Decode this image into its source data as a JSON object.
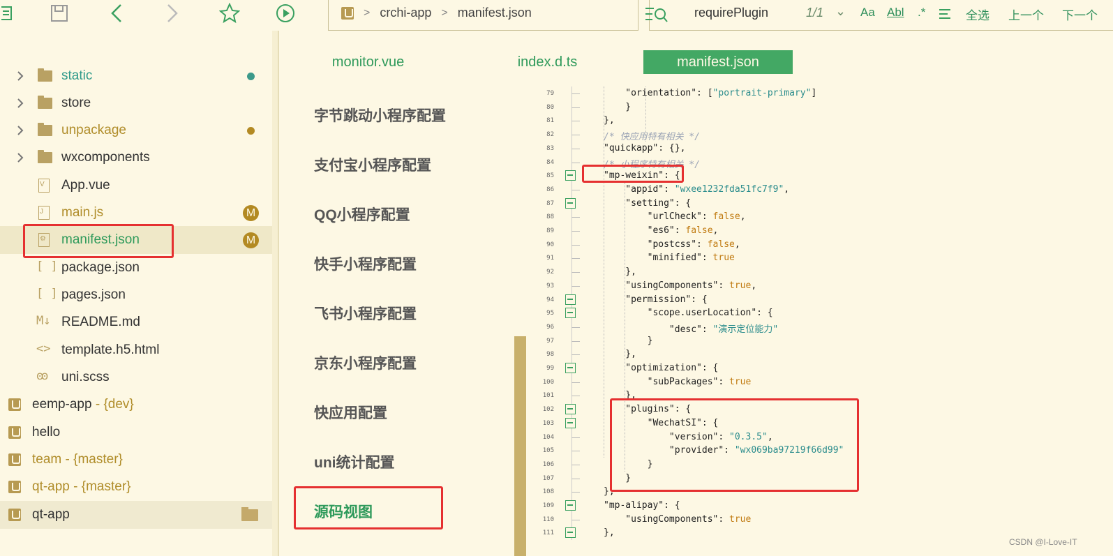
{
  "breadcrumb": {
    "project": "crchi-app",
    "file": "manifest.json"
  },
  "search": {
    "query": "requirePlugin",
    "count": "1/1",
    "aa": "Aa",
    "ab": "Abl",
    "regex": ".*",
    "select_all": "全选",
    "prev": "上一个",
    "next": "下一个"
  },
  "tree": {
    "folders": [
      "static",
      "store",
      "unpackage",
      "wxcomponents"
    ],
    "files": [
      "App.vue",
      "main.js",
      "manifest.json",
      "package.json",
      "pages.json",
      "README.md",
      "template.h5.html",
      "uni.scss"
    ],
    "file_glyphs": {
      "vue": "V",
      "js": "J",
      "json": "[ ]",
      "md": "M↓",
      "html": "<>",
      "scss": "ꙭ"
    },
    "badge_m": "M",
    "projects": [
      {
        "name": "eemp-app",
        "branch": " - {dev}"
      },
      {
        "name": "hello",
        "branch": ""
      },
      {
        "name": "team",
        "branch": " - {master}"
      },
      {
        "name": "qt-app",
        "branch": " - {master}"
      },
      {
        "name": "qt-app",
        "branch": ""
      }
    ]
  },
  "tabs": [
    "monitor.vue",
    "index.d.ts",
    "manifest.json"
  ],
  "nav": [
    "字节跳动小程序配置",
    "支付宝小程序配置",
    "QQ小程序配置",
    "快手小程序配置",
    "飞书小程序配置",
    "京东小程序配置",
    "快应用配置",
    "uni统计配置",
    "源码视图"
  ],
  "code": {
    "line_numbers": [
      "79",
      "80",
      "81",
      "82",
      "83",
      "84",
      "85",
      "86",
      "87",
      "88",
      "89",
      "90",
      "91",
      "92",
      "93",
      "94",
      "95",
      "96",
      "97",
      "98",
      "99",
      "100",
      "101",
      "102",
      "103",
      "104",
      "105",
      "106",
      "107",
      "108",
      "109",
      "110",
      "111"
    ],
    "lines": [
      [
        [
          "    \"orientation\": [",
          "k"
        ],
        [
          "\"portrait-primary\"",
          "s"
        ],
        [
          "]",
          "k"
        ]
      ],
      [
        [
          "    }",
          "k"
        ]
      ],
      [
        [
          "},",
          "k"
        ]
      ],
      [
        [
          "/* 快应用特有相关 */",
          "c"
        ]
      ],
      [
        [
          "\"quickapp\": {},",
          "k"
        ]
      ],
      [
        [
          "/* 小程序特有相关 */",
          "c"
        ]
      ],
      [
        [
          "\"mp-weixin\": {",
          "k"
        ]
      ],
      [
        [
          "    \"appid\": ",
          "k"
        ],
        [
          "\"wxee1232fda51fc7f9\"",
          "s"
        ],
        [
          ",",
          "k"
        ]
      ],
      [
        [
          "    \"setting\": {",
          "k"
        ]
      ],
      [
        [
          "        \"urlCheck\": ",
          "k"
        ],
        [
          "false",
          "b"
        ],
        [
          ",",
          "k"
        ]
      ],
      [
        [
          "        \"es6\": ",
          "k"
        ],
        [
          "false",
          "b"
        ],
        [
          ",",
          "k"
        ]
      ],
      [
        [
          "        \"postcss\": ",
          "k"
        ],
        [
          "false",
          "b"
        ],
        [
          ",",
          "k"
        ]
      ],
      [
        [
          "        \"minified\": ",
          "k"
        ],
        [
          "true",
          "b"
        ]
      ],
      [
        [
          "    },",
          "k"
        ]
      ],
      [
        [
          "    \"usingComponents\": ",
          "k"
        ],
        [
          "true",
          "b"
        ],
        [
          ",",
          "k"
        ]
      ],
      [
        [
          "    \"permission\": {",
          "k"
        ]
      ],
      [
        [
          "        \"scope.userLocation\": {",
          "k"
        ]
      ],
      [
        [
          "            \"desc\": ",
          "k"
        ],
        [
          "\"演示定位能力\"",
          "s"
        ]
      ],
      [
        [
          "        }",
          "k"
        ]
      ],
      [
        [
          "    },",
          "k"
        ]
      ],
      [
        [
          "    \"optimization\": {",
          "k"
        ]
      ],
      [
        [
          "        \"subPackages\": ",
          "k"
        ],
        [
          "true",
          "b"
        ]
      ],
      [
        [
          "    },",
          "k"
        ]
      ],
      [
        [
          "    \"plugins\": {",
          "k"
        ]
      ],
      [
        [
          "        \"WechatSI\": {",
          "k"
        ]
      ],
      [
        [
          "            \"version\": ",
          "k"
        ],
        [
          "\"0.3.5\"",
          "s"
        ],
        [
          ",",
          "k"
        ]
      ],
      [
        [
          "            \"provider\": ",
          "k"
        ],
        [
          "\"wx069ba97219f66d99\"",
          "s"
        ]
      ],
      [
        [
          "        }",
          "k"
        ]
      ],
      [
        [
          "    }",
          "k"
        ]
      ],
      [
        [
          "},",
          "k"
        ]
      ],
      [
        [
          "\"mp-alipay\": {",
          "k"
        ]
      ],
      [
        [
          "    \"usingComponents\": ",
          "k"
        ],
        [
          "true",
          "b"
        ]
      ],
      [
        [
          "},",
          "k"
        ]
      ]
    ]
  },
  "watermark": "CSDN @I-Love-IT",
  "colors": {
    "accent": "#43a864",
    "highlight": "#e53030",
    "background": "#fdf8e4"
  }
}
